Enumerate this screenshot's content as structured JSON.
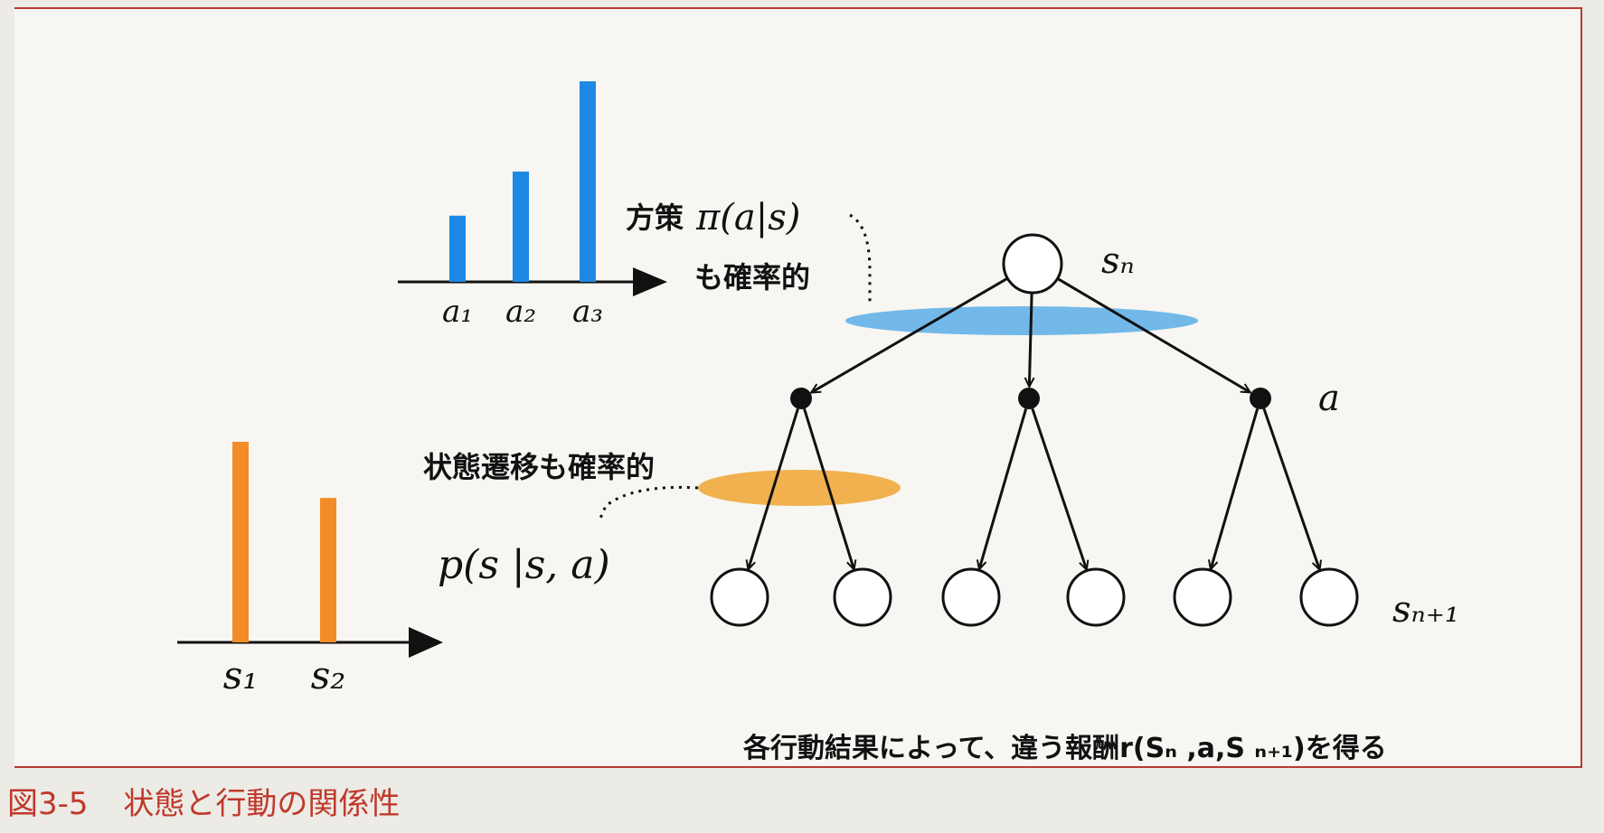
{
  "caption": {
    "number": "図3-5",
    "title": "状態と行動の関係性"
  },
  "colors": {
    "policy": "#1e88e5",
    "transition": "#f28c28",
    "policy_ellipse": "#5aaee8",
    "transition_ellipse": "#eeaa3c",
    "caption": "#c0392b"
  },
  "policy_chart": {
    "label_prefix": "方策",
    "formula": "π(a|s)",
    "label_line2": "も確率的",
    "ticks": [
      "a₁",
      "a₂",
      "a₃"
    ],
    "values": [
      0.33,
      0.55,
      1.0
    ]
  },
  "transition_chart": {
    "label": "状態遷移も確率的",
    "formula": "p(s |s, a)",
    "ticks": [
      "s₁",
      "s₂"
    ],
    "values": [
      1.0,
      0.72
    ]
  },
  "tree": {
    "root_label": "sₙ",
    "action_label": "a",
    "leaf_label": "sₙ₊₁",
    "action_count": 3,
    "leaf_count": 6
  },
  "reward_note": "各行動結果によって、違う報酬r(Sₙ ,a,S ₙ₊₁)を得る"
}
